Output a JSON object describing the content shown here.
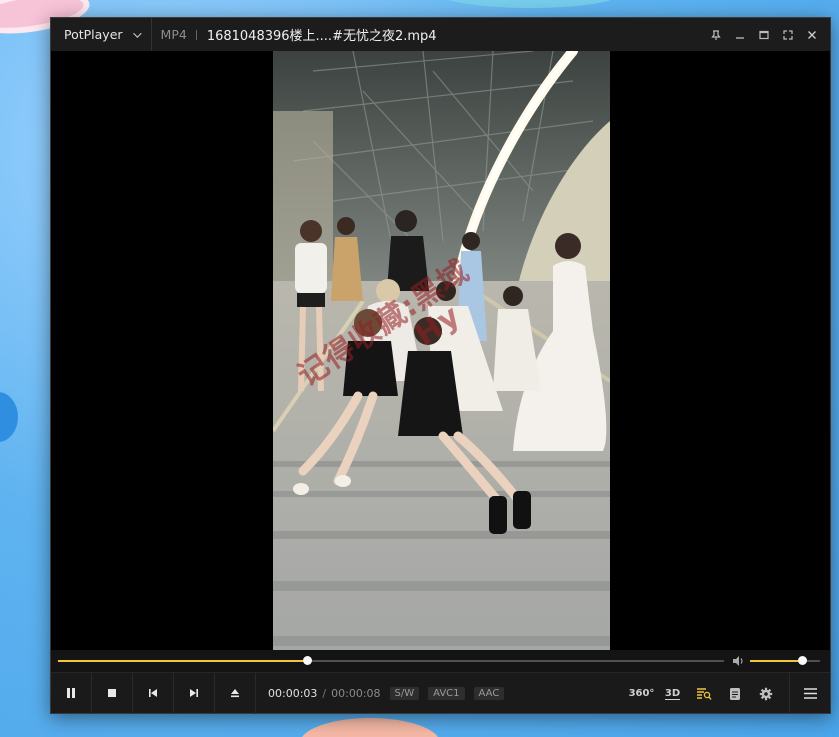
{
  "window": {
    "app_name": "PotPlayer",
    "format": "MP4",
    "file_title": "1681048396楼上....#无忧之夜2.mp4"
  },
  "video": {
    "watermark_line1": "记得收藏:黑域",
    "watermark_line2": "Hy"
  },
  "playback": {
    "progress": 0.375,
    "volume": 0.75,
    "current_time": "00:00:03",
    "separator": "/",
    "duration": "00:00:08",
    "badges": [
      "S/W",
      "AVC1",
      "AAC"
    ]
  },
  "toolbar": {
    "vr_label": "360°",
    "3d_label": "3D"
  },
  "colors": {
    "accent": "#f0c63a",
    "window_bg": "#101010",
    "titlebar_bg": "#1c1c1c"
  },
  "icons": [
    "chevron-down-icon",
    "pin-icon",
    "minimize-icon",
    "maximize-icon",
    "fullscreen-icon",
    "close-icon",
    "pause-icon",
    "stop-icon",
    "previous-icon",
    "next-icon",
    "eject-icon",
    "volume-icon",
    "playlist-search-icon",
    "subtitle-icon",
    "gear-icon",
    "menu-icon"
  ]
}
